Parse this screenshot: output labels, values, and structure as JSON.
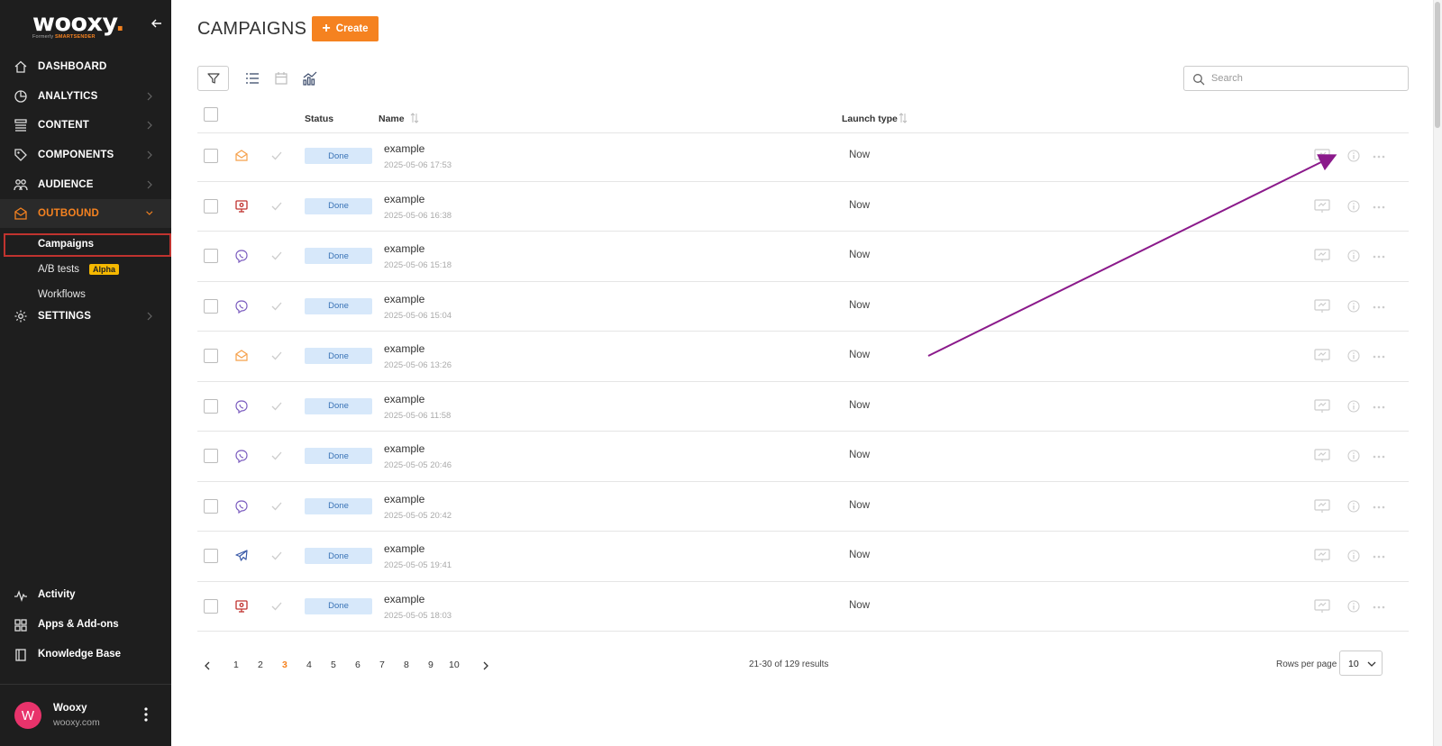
{
  "brand": {
    "name": "wooxy",
    "subtitle_prefix": "Formerly",
    "subtitle_brand": "SMARTSENDER",
    "accent": "#f58220"
  },
  "sidebar": {
    "nav": [
      {
        "label": "DASHBOARD",
        "icon": "home-icon"
      },
      {
        "label": "ANALYTICS",
        "icon": "pie-chart-icon"
      },
      {
        "label": "CONTENT",
        "icon": "content-icon"
      },
      {
        "label": "COMPONENTS",
        "icon": "tag-icon"
      },
      {
        "label": "AUDIENCE",
        "icon": "people-icon"
      },
      {
        "label": "OUTBOUND",
        "icon": "envelope-icon"
      },
      {
        "label": "SETTINGS",
        "icon": "gear-icon"
      }
    ],
    "outbound_sub": [
      {
        "label": "Campaigns"
      },
      {
        "label": "A/B tests",
        "badge": "Alpha"
      },
      {
        "label": "Workflows"
      }
    ],
    "bottom": [
      {
        "label": "Activity",
        "icon": "activity-icon"
      },
      {
        "label": "Apps & Add-ons",
        "icon": "apps-icon"
      },
      {
        "label": "Knowledge Base",
        "icon": "book-icon"
      }
    ],
    "user": {
      "initial": "W",
      "name": "Wooxy",
      "domain": "wooxy.com"
    }
  },
  "page": {
    "title": "CAMPAIGNS",
    "create_label": "Create"
  },
  "search": {
    "placeholder": "Search",
    "value": ""
  },
  "table": {
    "headers": {
      "status": "Status",
      "name": "Name",
      "launch_type": "Launch type"
    },
    "rows": [
      {
        "type": "email",
        "status": "Done",
        "name": "example",
        "date": "2025-05-06 17:53",
        "launch": "Now"
      },
      {
        "type": "web-push",
        "status": "Done",
        "name": "example",
        "date": "2025-05-06 16:38",
        "launch": "Now"
      },
      {
        "type": "viber",
        "status": "Done",
        "name": "example",
        "date": "2025-05-06 15:18",
        "launch": "Now"
      },
      {
        "type": "viber",
        "status": "Done",
        "name": "example",
        "date": "2025-05-06 15:04",
        "launch": "Now"
      },
      {
        "type": "email",
        "status": "Done",
        "name": "example",
        "date": "2025-05-06 13:26",
        "launch": "Now"
      },
      {
        "type": "viber",
        "status": "Done",
        "name": "example",
        "date": "2025-05-06 11:58",
        "launch": "Now"
      },
      {
        "type": "viber",
        "status": "Done",
        "name": "example",
        "date": "2025-05-05 20:46",
        "launch": "Now"
      },
      {
        "type": "viber",
        "status": "Done",
        "name": "example",
        "date": "2025-05-05 20:42",
        "launch": "Now"
      },
      {
        "type": "telegram",
        "status": "Done",
        "name": "example",
        "date": "2025-05-05 19:41",
        "launch": "Now"
      },
      {
        "type": "web-push",
        "status": "Done",
        "name": "example",
        "date": "2025-05-05 18:03",
        "launch": "Now"
      }
    ]
  },
  "pagination": {
    "pages": [
      "1",
      "2",
      "3",
      "4",
      "5",
      "6",
      "7",
      "8",
      "9",
      "10"
    ],
    "current": "3",
    "results": "21-30 of 129 results",
    "rows_per_page_label": "Rows per page",
    "rows_per_page": "10"
  },
  "colors": {
    "sidebar_bg": "#1e1e1e",
    "status_bg": "#d7e8fa",
    "status_text": "#3a73b6",
    "selection_border": "#c0332f",
    "annotation_arrow": "#8b1a8b",
    "avatar": "#e8336b"
  }
}
